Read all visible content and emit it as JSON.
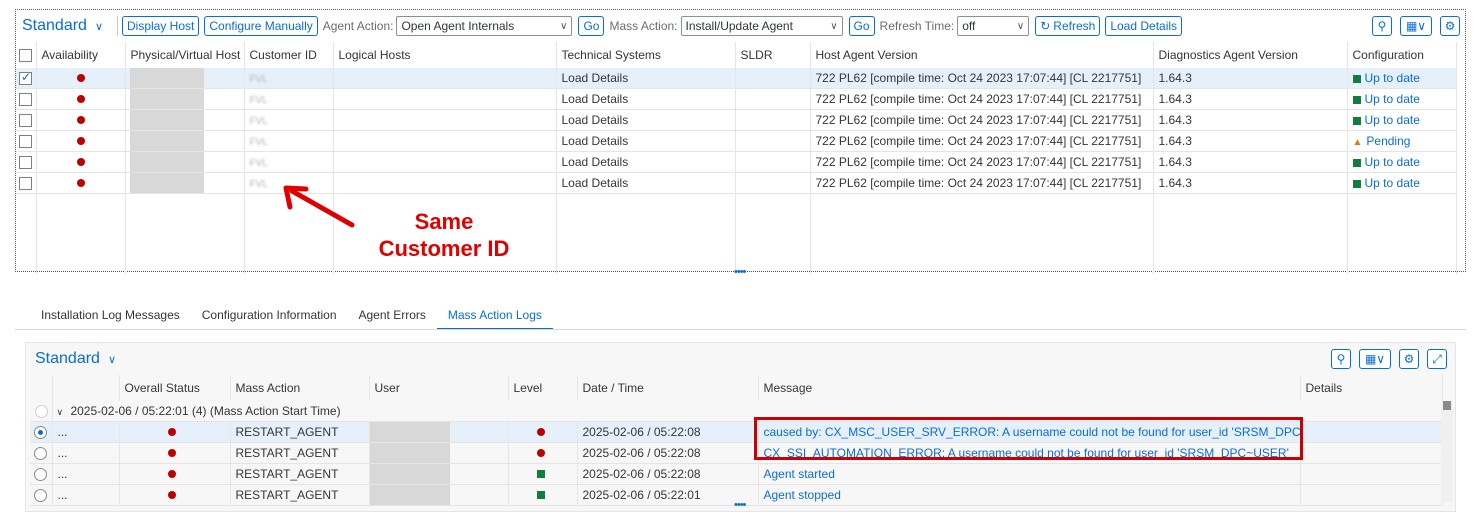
{
  "top": {
    "variant": "Standard",
    "toolbar": {
      "display_host": "Display Host",
      "configure_manually": "Configure Manually",
      "agent_action_label": "Agent Action:",
      "agent_action_value": "Open Agent Internals",
      "go": "Go",
      "mass_action_label": "Mass Action:",
      "mass_action_value": "Install/Update Agent",
      "refresh_time_label": "Refresh Time:",
      "refresh_time_value": "off",
      "refresh": "Refresh",
      "load_details": "Load Details"
    },
    "columns": [
      "Availability",
      "Physical/Virtual Host",
      "Customer ID",
      "Logical Hosts",
      "Technical Systems",
      "SLDR",
      "Host Agent Version",
      "Diagnostics Agent Version",
      "Configuration"
    ],
    "rows": [
      {
        "customer_id": "FVL",
        "technical_systems": "Load Details",
        "host_agent_version": "722 PL62 [compile time: Oct 24 2023 17:07:44] [CL 2217751]",
        "diag_version": "1.64.3",
        "configuration": "Up to date",
        "config_status": "ok"
      },
      {
        "customer_id": "FVL",
        "technical_systems": "Load Details",
        "host_agent_version": "722 PL62 [compile time: Oct 24 2023 17:07:44] [CL 2217751]",
        "diag_version": "1.64.3",
        "configuration": "Up to date",
        "config_status": "ok"
      },
      {
        "customer_id": "FVL",
        "technical_systems": "Load Details",
        "host_agent_version": "722 PL62 [compile time: Oct 24 2023 17:07:44] [CL 2217751]",
        "diag_version": "1.64.3",
        "configuration": "Up to date",
        "config_status": "ok"
      },
      {
        "customer_id": "FVL",
        "technical_systems": "Load Details",
        "host_agent_version": "722 PL62 [compile time: Oct 24 2023 17:07:44] [CL 2217751]",
        "diag_version": "1.64.3",
        "configuration": "Pending",
        "config_status": "pending"
      },
      {
        "customer_id": "FVL",
        "technical_systems": "Load Details",
        "host_agent_version": "722 PL62 [compile time: Oct 24 2023 17:07:44] [CL 2217751]",
        "diag_version": "1.64.3",
        "configuration": "Up to date",
        "config_status": "ok"
      },
      {
        "customer_id": "FVL",
        "technical_systems": "Load Details",
        "host_agent_version": "722 PL62 [compile time: Oct 24 2023 17:07:44] [CL 2217751]",
        "diag_version": "1.64.3",
        "configuration": "Up to date",
        "config_status": "ok"
      }
    ],
    "annotation": [
      "Same",
      "Customer ID"
    ]
  },
  "tabs": [
    "Installation Log Messages",
    "Configuration Information",
    "Agent Errors",
    "Mass Action Logs"
  ],
  "bottom": {
    "variant": "Standard",
    "columns": [
      "Overall Status",
      "Mass Action",
      "User",
      "Level",
      "Date / Time",
      "Message",
      "Details"
    ],
    "group_row": "2025-02-06 / 05:22:01 (4) (Mass Action Start Time)",
    "rows": [
      {
        "name": "...",
        "mass_action": "RESTART_AGENT",
        "datetime": "2025-02-06 / 05:22:08",
        "message": "caused by: CX_MSC_USER_SRV_ERROR: A username could not be found for user_id 'SRSM_DPC~USER'",
        "level": "error"
      },
      {
        "name": "...",
        "mass_action": "RESTART_AGENT",
        "datetime": "2025-02-06 / 05:22:08",
        "message": "CX_SSI_AUTOMATION_ERROR: A username could not be found for user_id 'SRSM_DPC~USER'",
        "level": "error"
      },
      {
        "name": "...",
        "mass_action": "RESTART_AGENT",
        "datetime": "2025-02-06 / 05:22:08",
        "message": "Agent started",
        "level": "success"
      },
      {
        "name": "...",
        "mass_action": "RESTART_AGENT",
        "datetime": "2025-02-06 / 05:22:01",
        "message": "Agent stopped",
        "level": "success"
      }
    ]
  },
  "colors": {
    "accent": "#0a6ed1",
    "error": "#bb0000",
    "success": "#107e3e",
    "warning": "#e9730c",
    "annotation": "#e00000"
  }
}
